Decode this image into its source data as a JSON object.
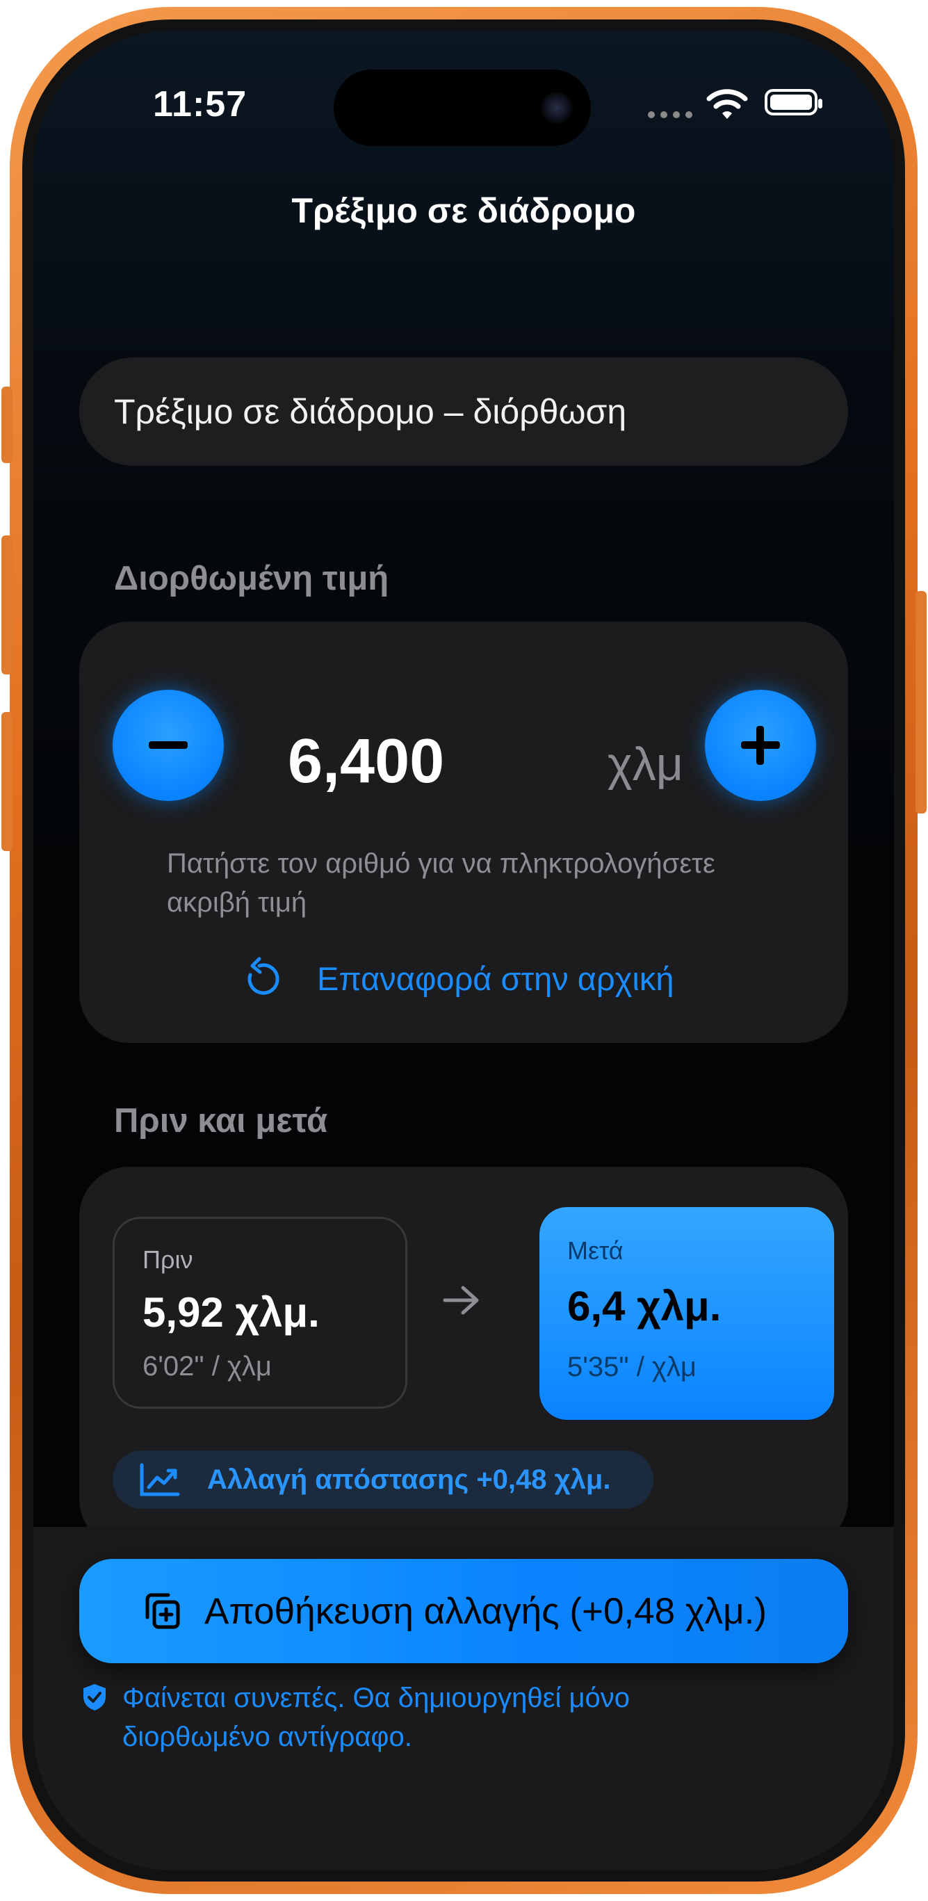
{
  "status_bar": {
    "time": "11:57"
  },
  "nav": {
    "title": "Τρέξιμο σε διάδρομο"
  },
  "name_field": {
    "value": "Τρέξιμο σε διάδρομο – διόρθωση"
  },
  "corrected_value": {
    "section_title": "Διορθωμένη τιμή",
    "value": "6,400",
    "unit": "χλμ",
    "hint": "Πατήστε τον αριθμό για να πληκτρολογήσετε ακριβή τιμή",
    "reset_label": "Επαναφορά στην αρχική"
  },
  "comparison": {
    "section_title": "Πριν και μετά",
    "before": {
      "caption": "Πριν",
      "value": "5,92 χλμ.",
      "pace": "6'02\" / χλμ"
    },
    "after": {
      "caption": "Μετά",
      "value": "6,4 χλμ.",
      "pace": "5'35\" / χλμ"
    },
    "change_label": "Αλλαγή απόστασης +0,48 χλμ."
  },
  "footer": {
    "save_label": "Αποθήκευση αλλαγής (+0,48 χλμ.)",
    "consistency_note": "Φαίνεται συνεπές. Θα δημιουργηθεί μόνο διορθωμένο αντίγραφο."
  },
  "colors": {
    "accent": "#0a84ff",
    "frame": "#e3701f",
    "card": "#1c1c1e",
    "background": "#030507"
  }
}
